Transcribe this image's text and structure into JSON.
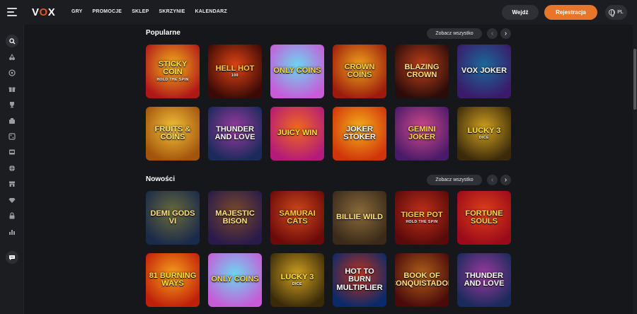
{
  "header": {
    "logo": {
      "left": "V",
      "o": "O",
      "right": "X"
    },
    "nav": [
      "GRY",
      "PROMOCJE",
      "SKLEP",
      "SKRZYNIE",
      "KALENDARZ"
    ],
    "login_label": "Wejdź",
    "register_label": "Rejestracja",
    "lang_label": "PL"
  },
  "sidebar": {
    "icons": [
      "search-icon",
      "cherries-icon",
      "roulette-icon",
      "gift-icon",
      "trophy-icon",
      "cards-icon",
      "dice-icon",
      "slot-machine-icon",
      "basketball-icon",
      "store-icon",
      "diamond-icon",
      "lock-icon",
      "chart-icon",
      "chat-icon"
    ]
  },
  "sections": {
    "popular": {
      "title": "Popularne",
      "see_all": "Zobacz wszystko",
      "games": [
        {
          "name": "STICKY COIN",
          "sub": "HOLD THE SPIN",
          "colors": [
            "#b01818",
            "#f2b21c"
          ],
          "text_color": "#ffe14d"
        },
        {
          "name": "HELL HOT",
          "sub": "100",
          "colors": [
            "#3b0a06",
            "#e04414"
          ],
          "text_color": "#ffcf3a"
        },
        {
          "name": "ONLY COINS",
          "sub": "",
          "colors": [
            "#c75bd8",
            "#6bd7f0"
          ],
          "text_color": "#ffd83a"
        },
        {
          "name": "CROWN COINS",
          "sub": "",
          "colors": [
            "#9c1c0c",
            "#f0a41c"
          ],
          "text_color": "#ffd84a"
        },
        {
          "name": "BLAZING CROWN",
          "sub": "",
          "colors": [
            "#2a0c0a",
            "#c0401a"
          ],
          "text_color": "#ffe07a"
        },
        {
          "name": "VOX JOKER",
          "sub": "",
          "colors": [
            "#3a1a6a",
            "#1a6a9a"
          ],
          "text_color": "#ffffff"
        },
        {
          "name": "FRUITS & COINS",
          "sub": "",
          "colors": [
            "#a2540c",
            "#f4c23a"
          ],
          "text_color": "#ffe86a"
        },
        {
          "name": "THUNDER AND LOVE",
          "sub": "",
          "colors": [
            "#1a2a5a",
            "#9a3aa0"
          ],
          "text_color": "#ffffff"
        },
        {
          "name": "JUICY WIN",
          "sub": "",
          "colors": [
            "#b41a7a",
            "#f06a1a"
          ],
          "text_color": "#ffe23a"
        },
        {
          "name": "JOKER STOKER",
          "sub": "",
          "colors": [
            "#d0340a",
            "#f6b01c"
          ],
          "text_color": "#ffffff"
        },
        {
          "name": "GEMINI JOKER",
          "sub": "",
          "colors": [
            "#4a1a6a",
            "#d04a8a"
          ],
          "text_color": "#ffd84a"
        },
        {
          "name": "LUCKY 3",
          "sub": "DICE",
          "colors": [
            "#3a2a0a",
            "#d0a020"
          ],
          "text_color": "#ffe23a"
        }
      ]
    },
    "new": {
      "title": "Nowości",
      "see_all": "Zobacz wszystko",
      "games": [
        {
          "name": "DEMI GODS VI",
          "sub": "",
          "colors": [
            "#1a2a4a",
            "#6a6a3a"
          ],
          "text_color": "#ffe27a"
        },
        {
          "name": "MAJESTIC BISON",
          "sub": "",
          "colors": [
            "#2a1a4a",
            "#7a4a2a"
          ],
          "text_color": "#ffe27a"
        },
        {
          "name": "SAMURAI CATS",
          "sub": "",
          "colors": [
            "#6a0a0a",
            "#d04a1a"
          ],
          "text_color": "#ffcf3a"
        },
        {
          "name": "BILLIE WILD",
          "sub": "",
          "colors": [
            "#3a2a1a",
            "#8a6a3a"
          ],
          "text_color": "#ffe27a"
        },
        {
          "name": "TIGER POT",
          "sub": "HOLD THE SPIN",
          "colors": [
            "#5a0a0a",
            "#c0301a"
          ],
          "text_color": "#ffcf3a"
        },
        {
          "name": "FORTUNE SOULS",
          "sub": "",
          "colors": [
            "#9a0a1a",
            "#e0401a"
          ],
          "text_color": "#ffd84a"
        },
        {
          "name": "81 BURNING WAYS",
          "sub": "",
          "colors": [
            "#c0200a",
            "#f8a01a"
          ],
          "text_color": "#ffe23a"
        },
        {
          "name": "ONLY COINS",
          "sub": "",
          "colors": [
            "#c75bd8",
            "#6bd7f0"
          ],
          "text_color": "#ffd83a"
        },
        {
          "name": "LUCKY 3",
          "sub": "DICE",
          "colors": [
            "#3a2a0a",
            "#d0a020"
          ],
          "text_color": "#ffe23a"
        },
        {
          "name": "HOT TO BURN MULTIPLIER",
          "sub": "",
          "colors": [
            "#0a2a6a",
            "#c0301a"
          ],
          "text_color": "#ffffff"
        },
        {
          "name": "BOOK OF CONQUISTADOR",
          "sub": "",
          "colors": [
            "#4a0a0a",
            "#b0601a"
          ],
          "text_color": "#ffe27a"
        },
        {
          "name": "THUNDER AND LOVE",
          "sub": "",
          "colors": [
            "#1a2a5a",
            "#9a3aa0"
          ],
          "text_color": "#ffffff"
        }
      ]
    }
  }
}
